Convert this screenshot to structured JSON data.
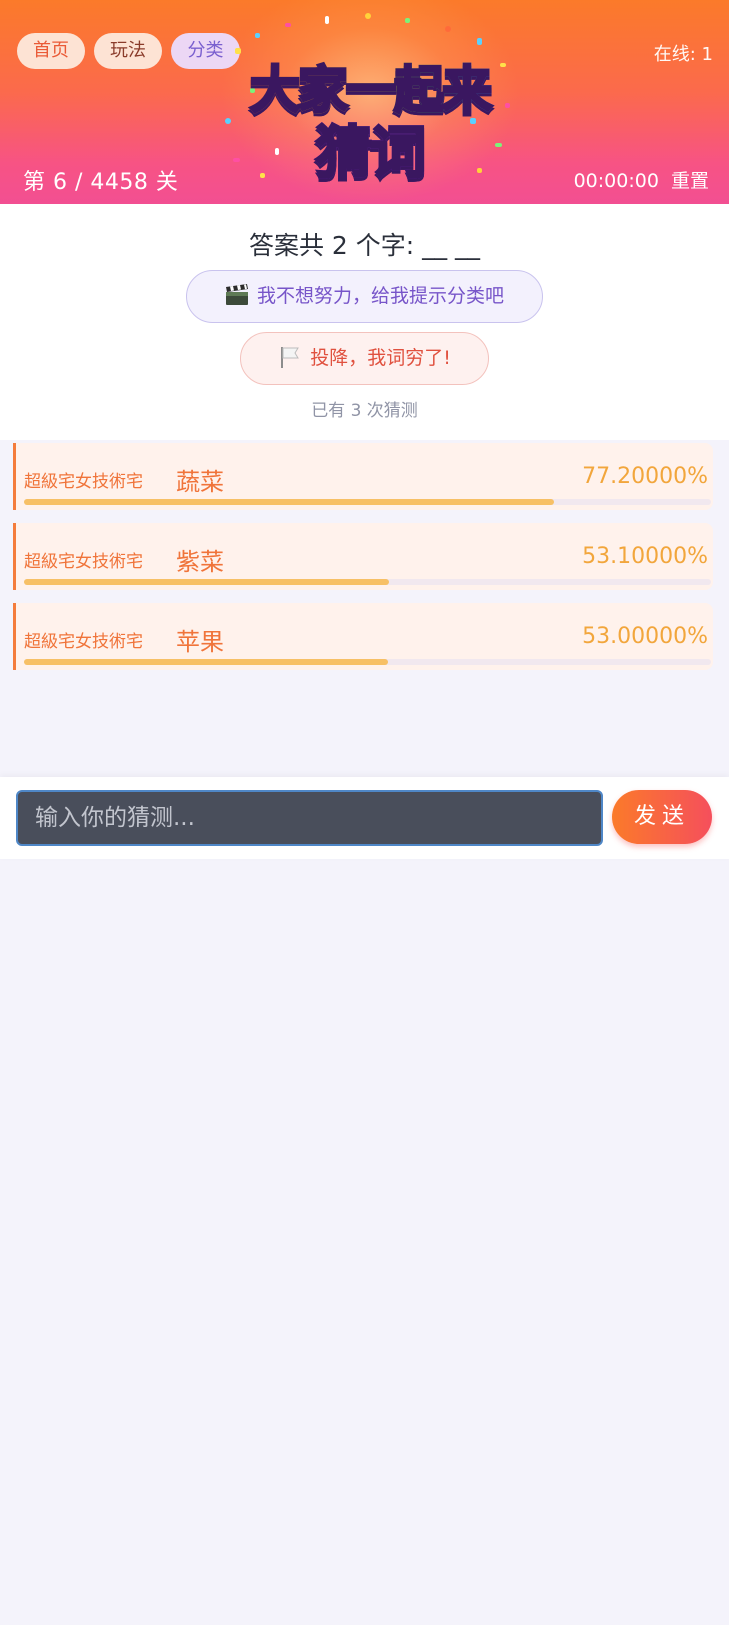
{
  "header": {
    "nav": [
      {
        "label": "首页"
      },
      {
        "label": "玩法"
      },
      {
        "label": "分类"
      }
    ],
    "online": "在线: 1",
    "logo_line1": "大家一起来",
    "logo_line2": "猜词",
    "level": "第 6 / 4458 关",
    "timer": "00:00:00",
    "reset_label": "重置"
  },
  "answer": {
    "title": "答案共 2 个字: __ __",
    "hint_button": "我不想努力，给我提示分类吧",
    "surrender_button": "投降，我词穷了!",
    "guess_count": "已有 3 次猜测"
  },
  "guesses": [
    {
      "user": "超級宅女技術宅",
      "word": "蔬菜",
      "score": "77.20000%",
      "similarity": 0.772
    },
    {
      "user": "超級宅女技術宅",
      "word": "紫菜",
      "score": "53.10000%",
      "similarity": 0.531
    },
    {
      "user": "超級宅女技術宅",
      "word": "苹果",
      "score": "53.00000%",
      "similarity": 0.53
    }
  ],
  "input": {
    "placeholder": "输入你的猜测...",
    "send_label": "发送"
  },
  "colors": {
    "header_top": "#fb7a2a",
    "header_bottom": "#f24f92",
    "accent_orange": "#f0743a",
    "score_gold": "#f2a63c",
    "hint_purple": "#7755c9",
    "surrender_red": "#e0513f"
  }
}
